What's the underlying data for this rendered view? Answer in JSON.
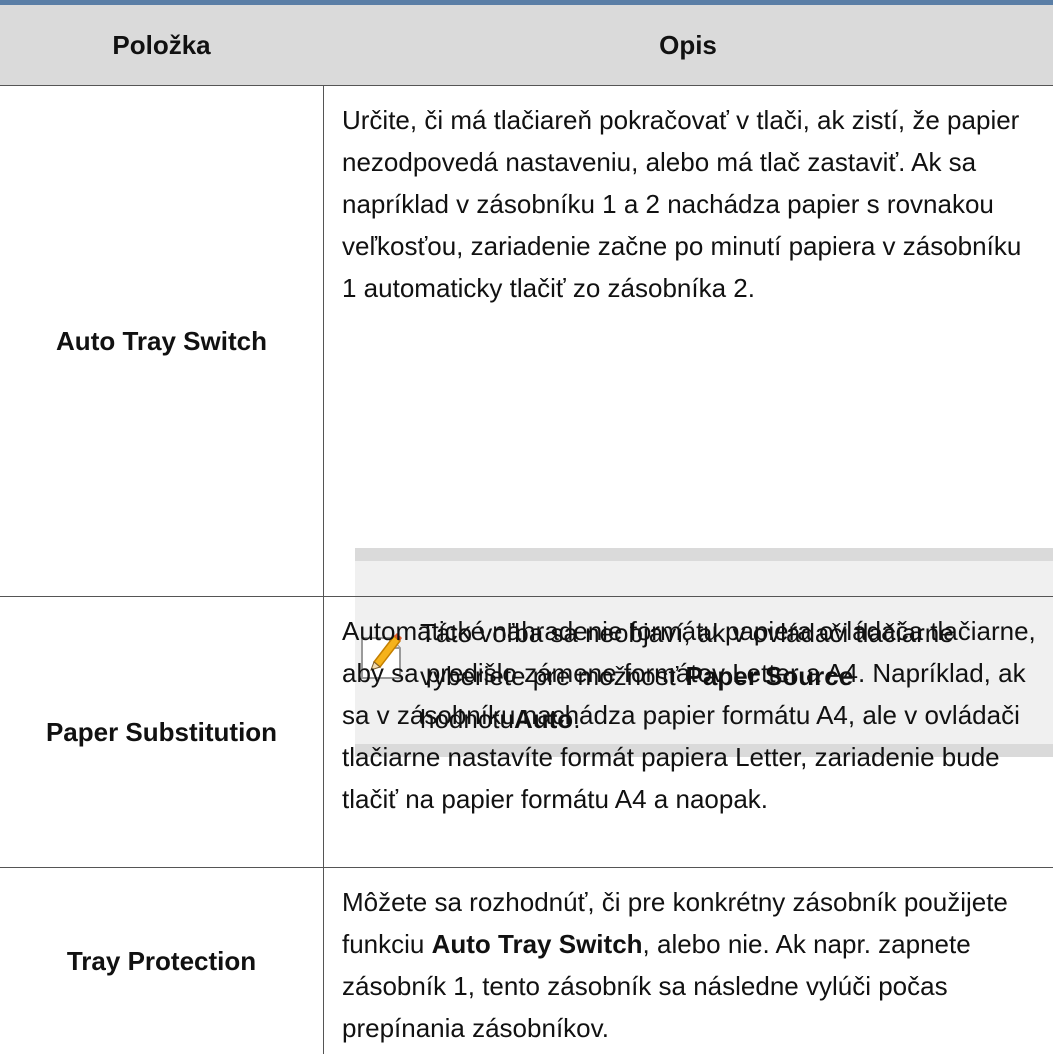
{
  "table": {
    "headers": {
      "item": "Položka",
      "description": "Opis"
    },
    "rows": [
      {
        "item": "Auto Tray Switch",
        "description": "Určite, či má tlačiareň pokračovať v tlači, ak zistí, že papier nezodpovedá nastaveniu, alebo má tlač zastaviť. Ak sa napríklad v zásobníku 1 a 2 nachádza papier s rovnakou veľkosťou, zariadenie začne po minutí papiera v zásobníku 1 automaticky tlačiť zo zásobníka 2.",
        "note": {
          "icon": "note-pencil-icon",
          "text_1": "Táto voľba sa neobjaví, ak v ovládači tlačiarne vyberiete pre možnosť ",
          "bold_1": "Paper Source",
          "text_2": " hodnotu",
          "bold_2": "Auto",
          "text_3": "."
        }
      },
      {
        "item": "Paper Substitution",
        "description": "Automatické nahradenie formátu papiera ovládača tlačiarne, aby sa predišlo zámene formátov Letter a A4. Napríklad, ak sa v zásobníku nachádza papier formátu A4, ale v ovládači tlačiarne nastavíte formát papiera Letter, zariadenie bude tlačiť na papier formátu A4 a naopak."
      },
      {
        "item": "Tray Protection",
        "description_1": "Môžete sa rozhodnúť, či pre konkrétny zásobník použijete funkciu ",
        "description_bold": "Auto Tray Switch",
        "description_2": ", alebo nie. Ak napr. zapnete zásobník 1, tento zásobník sa následne vylúči počas prepínania zásobníkov."
      }
    ]
  },
  "colors": {
    "top_bar": "#5a7ea6",
    "header_bg": "#dadada",
    "note_bg": "#f0f0f0",
    "note_border": "#dadada"
  }
}
